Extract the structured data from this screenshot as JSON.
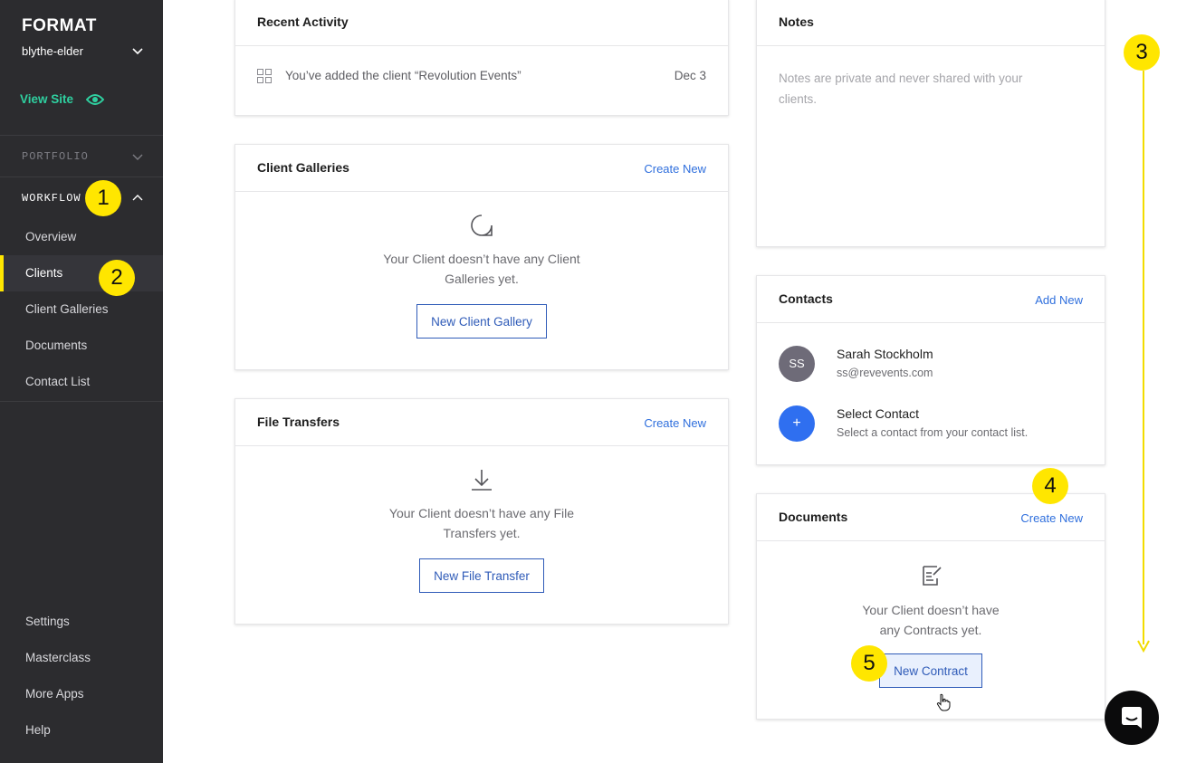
{
  "sidebar": {
    "logo": "FORMAT",
    "site_name": "blythe-elder",
    "view_site": "View Site",
    "sections": {
      "portfolio": "PORTFOLIO",
      "workflow": "WORKFLOW"
    },
    "items": [
      {
        "label": "Overview"
      },
      {
        "label": "Clients"
      },
      {
        "label": "Client Galleries"
      },
      {
        "label": "Documents"
      },
      {
        "label": "Contact List"
      }
    ],
    "bottom_items": [
      {
        "label": "Settings"
      },
      {
        "label": "Masterclass"
      },
      {
        "label": "More Apps"
      },
      {
        "label": "Help"
      }
    ]
  },
  "recent_activity": {
    "title": "Recent Activity",
    "item_text": "You’ve added the client “Revolution Events”",
    "item_date": "Dec 3"
  },
  "client_galleries": {
    "title": "Client Galleries",
    "link": "Create New",
    "empty_line1": "Your Client doesn’t have any Client",
    "empty_line2": "Galleries yet.",
    "button": "New Client Gallery"
  },
  "file_transfers": {
    "title": "File Transfers",
    "link": "Create New",
    "empty_line1": "Your Client doesn’t have any File",
    "empty_line2": "Transfers yet.",
    "button": "New File Transfer"
  },
  "notes": {
    "title": "Notes",
    "placeholder_line1": "Notes are private and never shared with your",
    "placeholder_line2": "clients."
  },
  "contacts": {
    "title": "Contacts",
    "link": "Add New",
    "primary": {
      "initials": "SS",
      "name": "Sarah Stockholm",
      "email": "ss@revevents.com"
    },
    "select": {
      "icon": "+",
      "name": "Select Contact",
      "sub": "Select a contact from your contact list."
    }
  },
  "documents": {
    "title": "Documents",
    "link": "Create New",
    "empty_line1": "Your Client doesn’t have",
    "empty_line2": "any Contracts yet.",
    "button": "New Contract"
  },
  "annotations": [
    "1",
    "2",
    "3",
    "4",
    "5"
  ],
  "colors": {
    "accent_yellow": "#ffe600",
    "link_blue": "#2f6fdd",
    "view_site_green": "#2fd0a0",
    "sidebar_bg": "#2c2c2f"
  }
}
